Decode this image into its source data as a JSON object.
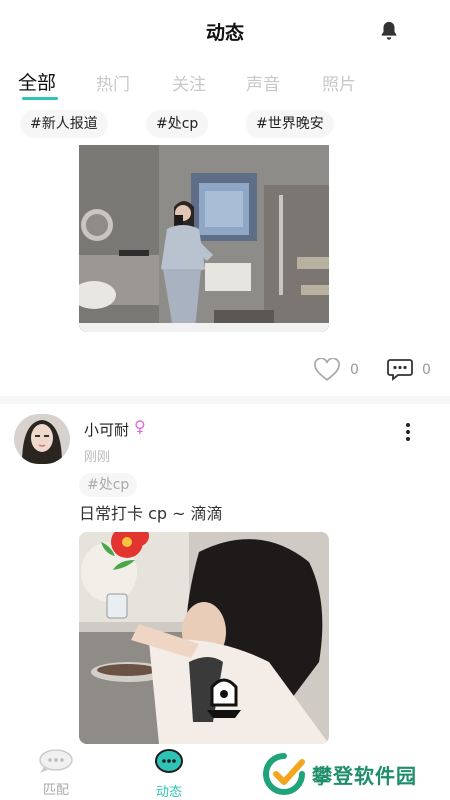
{
  "header": {
    "title": "动态",
    "bell_icon": "bell-icon"
  },
  "tabs": [
    {
      "label": "全部",
      "active": true
    },
    {
      "label": "热门",
      "active": false
    },
    {
      "label": "关注",
      "active": false
    },
    {
      "label": "声音",
      "active": false
    },
    {
      "label": "照片",
      "active": false
    }
  ],
  "topics": [
    "#新人报道",
    "#处cp",
    "#世界晚安"
  ],
  "post1": {
    "like_count": "0",
    "comment_count": "0"
  },
  "post2": {
    "username": "小可耐",
    "gender_symbol": "♀",
    "time": "刚刚",
    "tag": "#处cp",
    "text": "日常打卡 cp ~ 滴滴"
  },
  "bottom_nav": [
    {
      "label": "匹配",
      "icon": "chat-bubble-icon",
      "active": false
    },
    {
      "label": "动态",
      "icon": "chat-dots-icon",
      "active": true
    }
  ],
  "watermark": {
    "text": "攀登软件园"
  },
  "colors": {
    "accent": "#2ec3b5",
    "gender": "#e06ad8",
    "muted": "#c8c8c8"
  }
}
